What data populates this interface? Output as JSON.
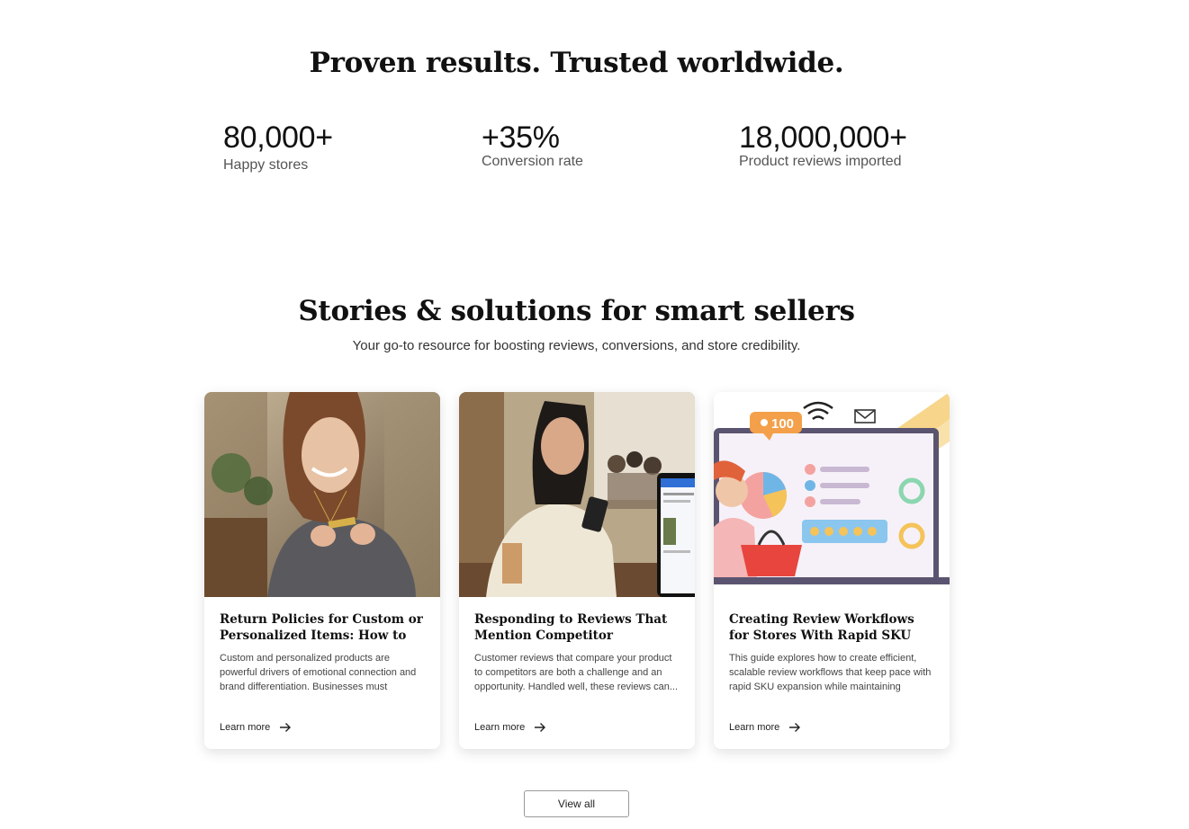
{
  "hero": {
    "title": "Proven results. Trusted worldwide."
  },
  "stats": [
    {
      "value": "80,000+",
      "label": "Happy stores"
    },
    {
      "value": "+35%",
      "label": "Conversion rate"
    },
    {
      "value": "18,000,000+",
      "label": "Product reviews imported"
    }
  ],
  "section": {
    "title": "Stories & solutions for smart sellers",
    "subtitle": "Your go-to resource for boosting reviews, conversions, and store credibility."
  },
  "cards": [
    {
      "title": "Return Policies for Custom or Personalized Items: How to Balanc...",
      "description": "Custom and personalized products are powerful drivers of emotional connection and brand differentiation. Businesses must carefull...",
      "link": "Learn more",
      "image": "woman-necklace-photo"
    },
    {
      "title": "Responding to Reviews That Mention Competitor Comparisons",
      "description": "Customer reviews that compare your product to competitors are both a challenge and an opportunity. Handled well, these reviews can...",
      "link": "Learn more",
      "image": "woman-phone-cafe-photo"
    },
    {
      "title": "Creating Review Workflows for Stores With Rapid SKU Expansion",
      "description": "This guide explores how to create efficient, scalable review workflows that keep pace with rapid SKU expansion while maintaining qualit...",
      "link": "Learn more",
      "image": "review-dashboard-illustration",
      "illustration_badge": "100"
    }
  ],
  "view_all": "View all"
}
